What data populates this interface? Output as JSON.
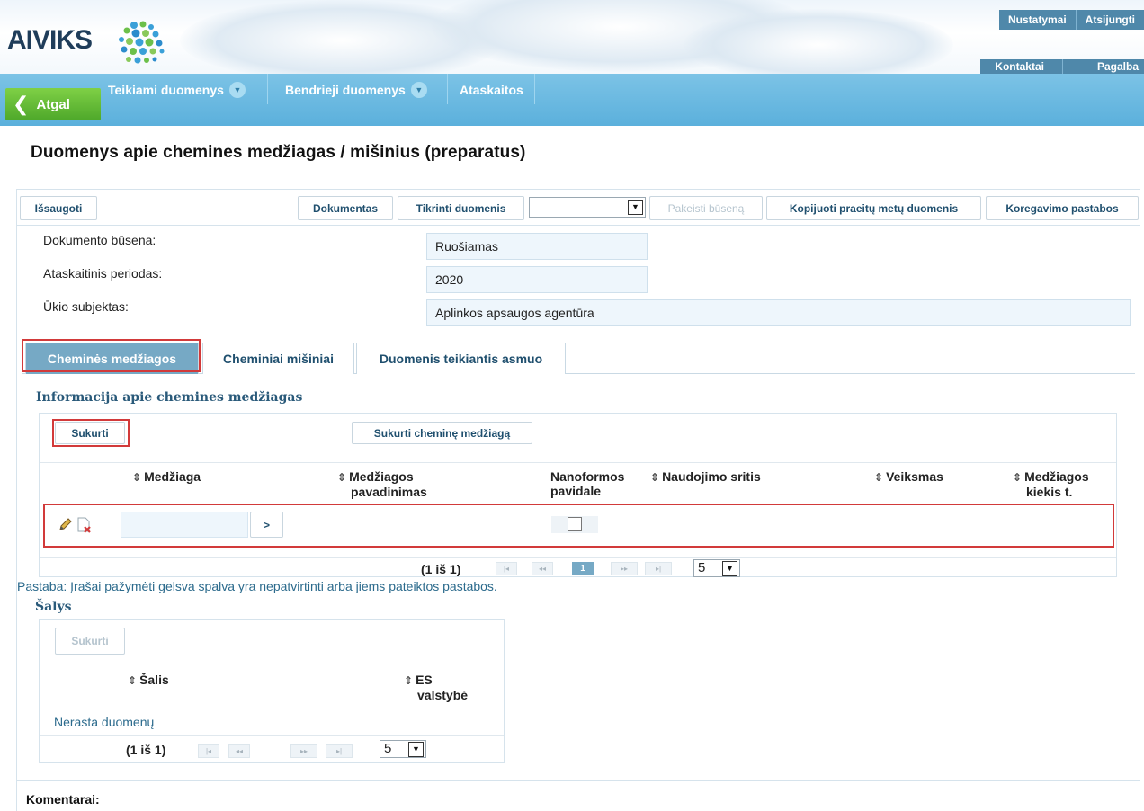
{
  "header": {
    "logo_text": "AIVIKS",
    "top_links": [
      "Nustatymai",
      "Atsijungti"
    ],
    "bottom_links": [
      "Kontaktai",
      "Pagalba"
    ]
  },
  "nav": {
    "back_label": "Atgal",
    "items": [
      "Teikiami duomenys",
      "Bendrieji duomenys",
      "Ataskaitos"
    ]
  },
  "page": {
    "title": "Duomenys apie chemines medžiagas / mišinius (preparatus)"
  },
  "toolbar": {
    "save_label": "Išsaugoti",
    "document_label": "Dokumentas",
    "check_label": "Tikrinti duomenis",
    "state_select_value": "",
    "change_state_label": "Pakeisti būseną",
    "copy_label": "Kopijuoti praeitų metų duomenis",
    "correction_label": "Koregavimo pastabos"
  },
  "fields": {
    "status_label": "Dokumento būsena:",
    "status_value": "Ruošiamas",
    "period_label": "Ataskaitinis periodas:",
    "period_value": "2020",
    "entity_label": "Ūkio subjektas:",
    "entity_value": "Aplinkos apsaugos agentūra"
  },
  "tabs": [
    "Cheminės medžiagos",
    "Cheminiai mišiniai",
    "Duomenis teikiantis asmuo"
  ],
  "substances": {
    "title": "Informacija apie chemines medžiagas",
    "create_label": "Sukurti",
    "create_chemical_label": "Sukurti cheminę medžiagą",
    "columns": {
      "substance": "Medžiaga",
      "name_line1": "Medžiagos",
      "name_line2": "pavadinimas",
      "nano_line1": "Nanoformos",
      "nano_line2": "pavidale",
      "usage": "Naudojimo sritis",
      "action": "Veiksmas",
      "amount_line1": "Medžiagos",
      "amount_line2": "kiekis t."
    },
    "row": {
      "substance_value": "",
      "lookup_label": ">"
    },
    "pager": {
      "text": "(1 iš 1)",
      "current": "1",
      "rows": "5"
    }
  },
  "note": "Pastaba: Įrašai pažymėti gelsva spalva yra nepatvirtinti arba jiems pateiktos pastabos.",
  "countries": {
    "title": "Šalys",
    "create_label": "Sukurti",
    "col_country": "Šalis",
    "col_eu_line1": "ES",
    "col_eu_line2": "valstybė",
    "empty": "Nerasta duomenų",
    "pager": {
      "text": "(1 iš 1)",
      "rows": "5"
    }
  },
  "comments_label": "Komentarai:"
}
